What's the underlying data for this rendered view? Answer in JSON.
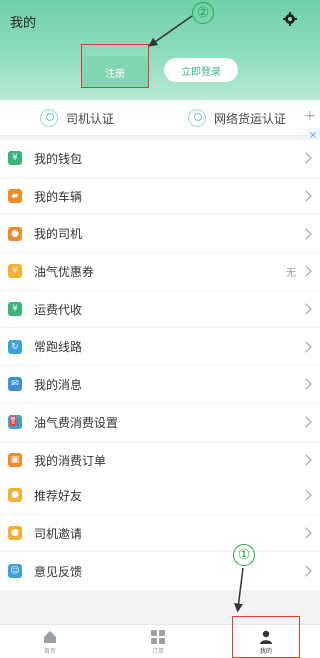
{
  "header": {
    "title": "我的",
    "register_label": "注册",
    "login_label": "立即登录"
  },
  "cert": {
    "driver": "司机认证",
    "freight": "网络货运认证",
    "plus": "+",
    "close": "×"
  },
  "menu": {
    "group1": [
      {
        "label": "我的钱包",
        "icon": "wallet-icon",
        "color": "#3bb37a",
        "glyph": "¥"
      },
      {
        "label": "我的车辆",
        "icon": "truck-icon",
        "color": "#f28c28",
        "glyph": "▰"
      },
      {
        "label": "我的司机",
        "icon": "driver-icon",
        "color": "#f28c28",
        "glyph": "●"
      },
      {
        "label": "油气优惠券",
        "icon": "coupon-icon",
        "color": "#f2b035",
        "glyph": "¥",
        "extra": "无"
      },
      {
        "label": "运费代收",
        "icon": "freight-collect-icon",
        "color": "#3bb37a",
        "glyph": "¥"
      },
      {
        "label": "常跑线路",
        "icon": "route-icon",
        "color": "#3aa4d8",
        "glyph": "↻"
      },
      {
        "label": "我的消息",
        "icon": "message-icon",
        "color": "#3a8fd8",
        "glyph": "✉"
      },
      {
        "label": "油气费消费设置",
        "icon": "fuel-icon",
        "color": "#3aa4d8",
        "glyph": "⛽"
      },
      {
        "label": "我的消费订单",
        "icon": "gift-icon",
        "color": "#f28c28",
        "glyph": "▣"
      }
    ],
    "group2": [
      {
        "label": "推荐好友",
        "icon": "recommend-icon",
        "color": "#f2b035",
        "glyph": "●"
      },
      {
        "label": "司机邀请",
        "icon": "invite-icon",
        "color": "#f2b035",
        "glyph": "●"
      },
      {
        "label": "意见反馈",
        "icon": "feedback-icon",
        "color": "#3aa4d8",
        "glyph": "☺"
      }
    ]
  },
  "tabs": [
    {
      "label": "首页",
      "icon": "home-icon"
    },
    {
      "label": "订单",
      "icon": "order-icon"
    },
    {
      "label": "我的",
      "icon": "profile-icon"
    }
  ],
  "annotations": {
    "one": "①",
    "two": "②"
  }
}
